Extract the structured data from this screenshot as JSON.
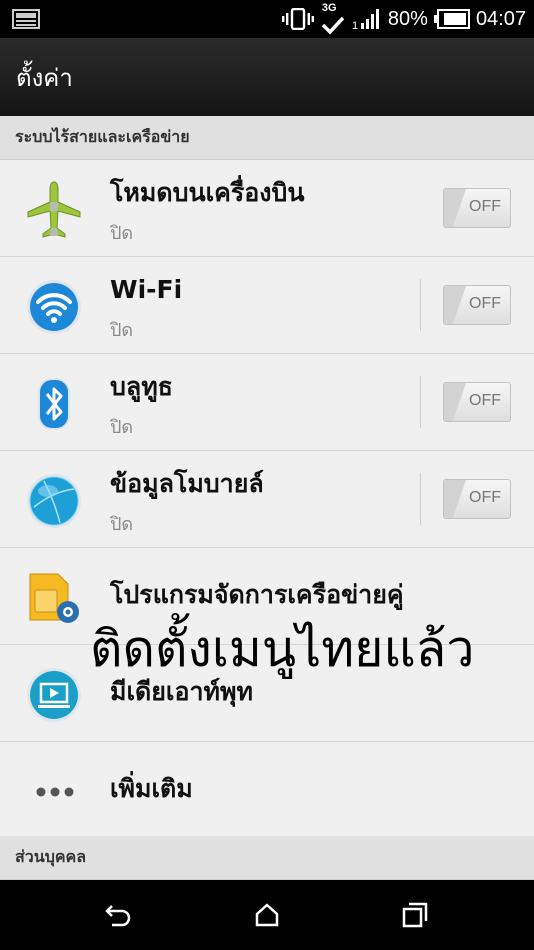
{
  "status_bar": {
    "network": "3G",
    "battery_percent": "80%",
    "time": "04:07",
    "icons": [
      "notification-icon",
      "vibrate-icon",
      "3g-icon",
      "signal-icon",
      "battery-icon"
    ]
  },
  "action_bar": {
    "title": "ตั้งค่า"
  },
  "sections": {
    "wireless": "ระบบไร้สายและเครือข่าย",
    "personal": "ส่วนบุคคล"
  },
  "items": [
    {
      "label": "โหมดบนเครื่องบิน",
      "sub": "ปิด",
      "toggle": "OFF",
      "icon": "airplane-icon"
    },
    {
      "label": "Wi-Fi",
      "sub": "ปิด",
      "toggle": "OFF",
      "icon": "wifi-icon"
    },
    {
      "label": "บลูทูธ",
      "sub": "ปิด",
      "toggle": "OFF",
      "icon": "bluetooth-icon"
    },
    {
      "label": "ข้อมูลโมบายล์",
      "sub": "ปิด",
      "toggle": "OFF",
      "icon": "mobile-data-icon"
    },
    {
      "label": "โปรแกรมจัดการเครือข่ายคู่",
      "icon": "dual-network-sim-icon"
    },
    {
      "label": "มีเดียเอาท์พุท",
      "icon": "media-output-icon"
    },
    {
      "label": "เพิ่มเติม",
      "icon": "more-dots-icon"
    }
  ],
  "overlay_text": "ติดตั้งเมนูไทยแล้ว",
  "nav_bar": {
    "icons": [
      "back-icon",
      "home-icon",
      "recent-apps-icon"
    ]
  },
  "colors": {
    "accent_blue": "#1e88d8",
    "airplane_green": "#9cc63b",
    "sim_yellow": "#f5b921"
  }
}
